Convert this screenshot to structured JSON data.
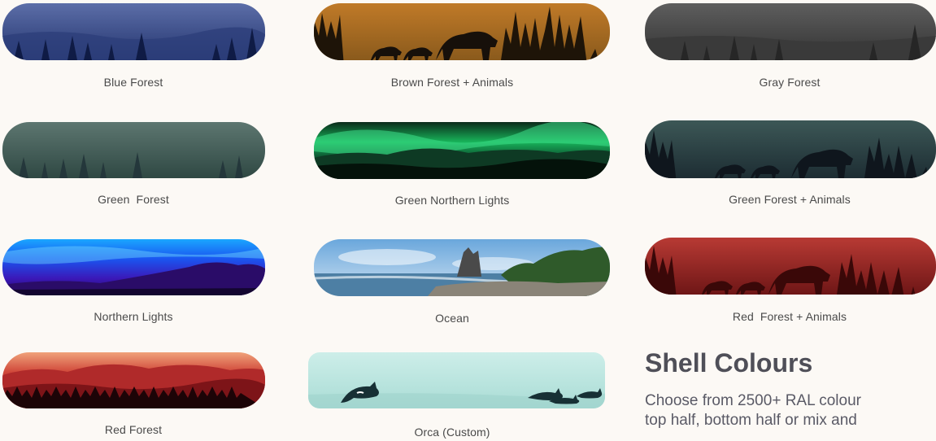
{
  "gallery": {
    "items": [
      {
        "caption": "Blue Forest"
      },
      {
        "caption": "Brown Forest + Animals"
      },
      {
        "caption": "Gray Forest"
      },
      {
        "caption": "Green  Forest"
      },
      {
        "caption": "Green Northern Lights"
      },
      {
        "caption": "Green Forest + Animals"
      },
      {
        "caption": "Northern Lights"
      },
      {
        "caption": "Ocean"
      },
      {
        "caption": "Red  Forest + Animals"
      },
      {
        "caption": "Red Forest"
      },
      {
        "caption": "Orca (Custom)"
      }
    ]
  },
  "shell": {
    "title": "Shell Colours",
    "line1": "Choose from 2500+ RAL colour",
    "line2": "top half, bottom half or mix and"
  }
}
